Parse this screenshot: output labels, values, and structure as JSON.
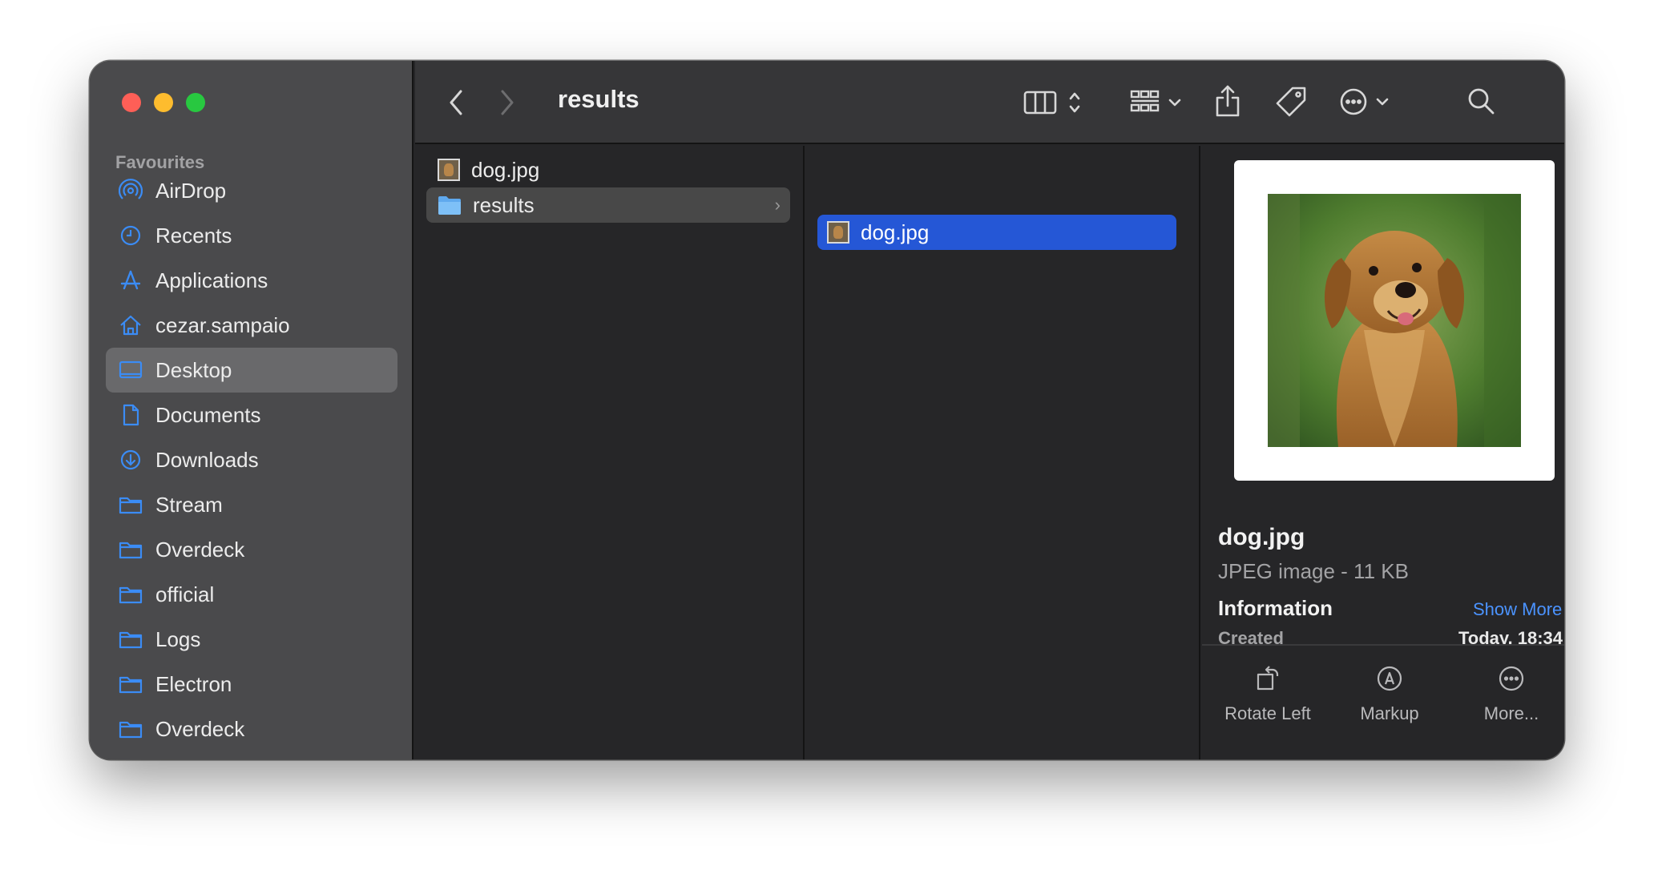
{
  "toolbar": {
    "title": "results"
  },
  "sidebar": {
    "section": "Favourites",
    "items": [
      {
        "label": "AirDrop",
        "icon": "airdrop-icon"
      },
      {
        "label": "Recents",
        "icon": "clock-icon"
      },
      {
        "label": "Applications",
        "icon": "applications-icon"
      },
      {
        "label": "cezar.sampaio",
        "icon": "home-icon"
      },
      {
        "label": "Desktop",
        "icon": "desktop-icon",
        "selected": true
      },
      {
        "label": "Documents",
        "icon": "document-icon"
      },
      {
        "label": "Downloads",
        "icon": "download-icon"
      },
      {
        "label": "Stream",
        "icon": "folder-icon"
      },
      {
        "label": "Overdeck",
        "icon": "folder-icon"
      },
      {
        "label": "official",
        "icon": "folder-icon"
      },
      {
        "label": "Logs",
        "icon": "folder-icon"
      },
      {
        "label": "Electron",
        "icon": "folder-icon"
      },
      {
        "label": "Overdeck",
        "icon": "folder-icon"
      }
    ]
  },
  "columns": {
    "col1": [
      {
        "name": "dog.jpg"
      },
      {
        "name": "results",
        "chevron": "›"
      }
    ],
    "col2": [
      {
        "name": "dog.jpg"
      }
    ]
  },
  "preview": {
    "name": "dog.jpg",
    "kind": "JPEG image - 11 KB",
    "info_heading": "Information",
    "show_more": "Show More",
    "created_label": "Created",
    "created_value": "Today, 18:34",
    "actions": [
      {
        "label": "Rotate Left",
        "icon": "rotate-left-icon"
      },
      {
        "label": "Markup",
        "icon": "markup-icon"
      },
      {
        "label": "More...",
        "icon": "more-icon"
      }
    ]
  },
  "colors": {
    "accent": "#2557d6",
    "link": "#4b93ff",
    "sidebar_icon": "#3b8cf5"
  }
}
